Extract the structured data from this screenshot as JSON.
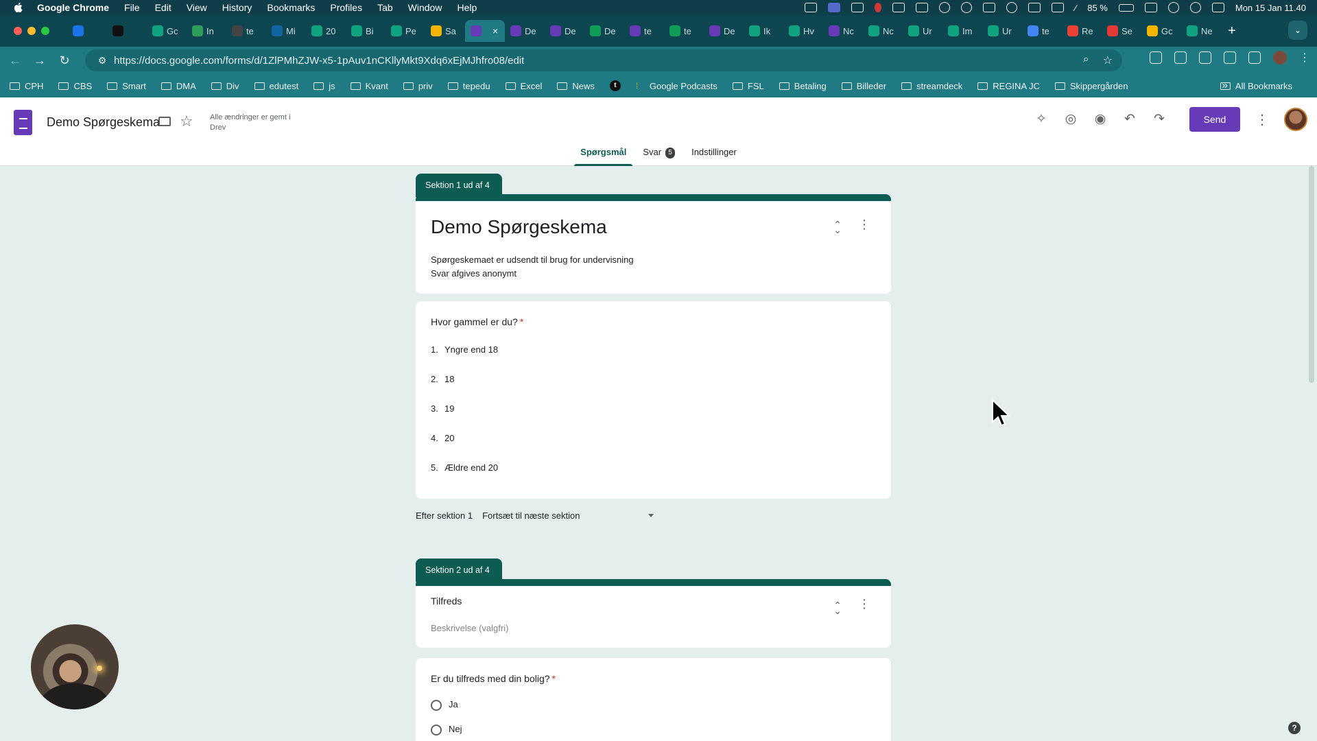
{
  "os_menubar": {
    "app_name": "Google Chrome",
    "menus": [
      "File",
      "Edit",
      "View",
      "History",
      "Bookmarks",
      "Profiles",
      "Tab",
      "Window",
      "Help"
    ],
    "battery": "85 %",
    "clock": "Mon 15 Jan 11.40"
  },
  "tabs": [
    {
      "label": "",
      "color": "#1a73e8"
    },
    {
      "label": "",
      "color": "#111111"
    },
    {
      "label": "Gc",
      "color": "#10a37f"
    },
    {
      "label": "In",
      "color": "#2e9e5b"
    },
    {
      "label": "te",
      "color": "#444444"
    },
    {
      "label": "Mi",
      "color": "#1264a3"
    },
    {
      "label": "20",
      "color": "#10a37f"
    },
    {
      "label": "Bi",
      "color": "#10a37f"
    },
    {
      "label": "Pe",
      "color": "#10a37f"
    },
    {
      "label": "Sa",
      "color": "#f4b400"
    },
    {
      "label": "",
      "color": "#673ab7",
      "active": true
    },
    {
      "label": "De",
      "color": "#673ab7"
    },
    {
      "label": "De",
      "color": "#673ab7"
    },
    {
      "label": "De",
      "color": "#0f9d58"
    },
    {
      "label": "te",
      "color": "#673ab7"
    },
    {
      "label": "te",
      "color": "#0f9d58"
    },
    {
      "label": "De",
      "color": "#673ab7"
    },
    {
      "label": "Ik",
      "color": "#10a37f"
    },
    {
      "label": "Hv",
      "color": "#10a37f"
    },
    {
      "label": "Nc",
      "color": "#673ab7"
    },
    {
      "label": "Nc",
      "color": "#10a37f"
    },
    {
      "label": "Ur",
      "color": "#10a37f"
    },
    {
      "label": "Im",
      "color": "#10a37f"
    },
    {
      "label": "Ur",
      "color": "#10a37f"
    },
    {
      "label": "te",
      "color": "#4285f4"
    },
    {
      "label": "Re",
      "color": "#ea4335"
    },
    {
      "label": "Se",
      "color": "#e53935"
    },
    {
      "label": "Gc",
      "color": "#f4b400"
    },
    {
      "label": "Ne",
      "color": "#10a37f"
    }
  ],
  "address_bar": {
    "url": "https://docs.google.com/forms/d/1ZlPMhZJW-x5-1pAuv1nCKllyMkt9Xdq6xEjMJhfro08/edit"
  },
  "bookmarks": [
    "CPH",
    "CBS",
    "Smart",
    "DMA",
    "Div",
    "edutest",
    "js",
    "Kvant",
    "priv",
    "tepedu",
    "Excel",
    "News",
    "Google Podcasts",
    "FSL",
    "Betaling",
    "Billeder",
    "streamdeck",
    "REGINA JC",
    "Skippergården"
  ],
  "bookmarks_all": "All Bookmarks",
  "forms_header": {
    "title": "Demo Spørgeskema",
    "saved_status": "Alle ændringer er gemt i Drev",
    "send_label": "Send",
    "tabs": {
      "questions": "Spørgsmål",
      "responses": "Svar",
      "responses_count": "5",
      "settings": "Indstillinger"
    }
  },
  "section1": {
    "tab": "Sektion 1 ud af 4",
    "title": "Demo Spørgeskema",
    "description_line1": "Spørgeskemaet er udsendt til brug for undervisning",
    "description_line2": "Svar afgives anonymt"
  },
  "question1": {
    "title": "Hvor gammel er du?",
    "required_mark": "*",
    "options": [
      {
        "num": "1.",
        "label": "Yngre end 18"
      },
      {
        "num": "2.",
        "label": "18"
      },
      {
        "num": "3.",
        "label": "19"
      },
      {
        "num": "4.",
        "label": "20"
      },
      {
        "num": "5.",
        "label": "Ældre end 20"
      }
    ]
  },
  "after_section": {
    "label": "Efter sektion 1",
    "value": "Fortsæt til næste sektion"
  },
  "section2": {
    "tab": "Sektion 2 ud af 4",
    "title": "Tilfreds",
    "description_placeholder": "Beskrivelse (valgfri)"
  },
  "question2": {
    "title": "Er du tilfreds med din bolig?",
    "required_mark": "*",
    "options": [
      "Ja",
      "Nej"
    ]
  },
  "colors": {
    "theme": "#0d5c52",
    "background": "#e4eeec",
    "forms_purple": "#673ab7",
    "required": "#d93025"
  }
}
